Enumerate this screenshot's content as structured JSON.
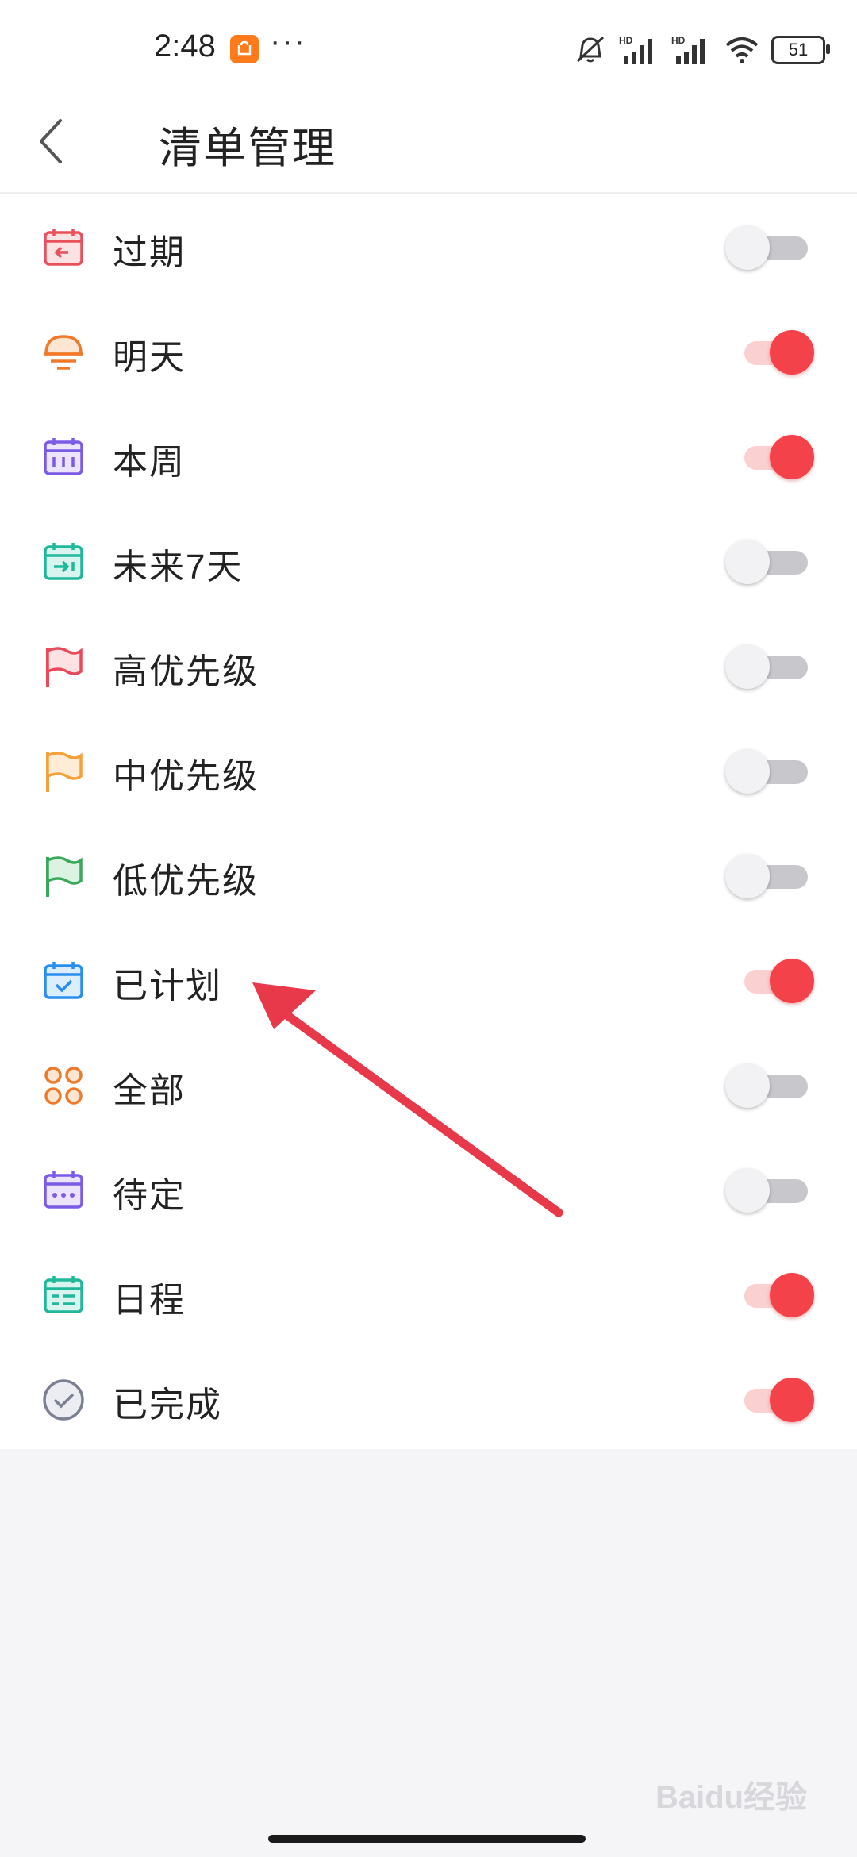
{
  "status_bar": {
    "time": "2:48",
    "dots": "···",
    "battery": "51",
    "icons": [
      "taobao-app-icon",
      "mute-icon",
      "signal-hd-icon",
      "signal-hd-icon",
      "wifi-icon",
      "battery-icon"
    ]
  },
  "header": {
    "title": "清单管理",
    "back_icon": "chevron-left-icon"
  },
  "items": [
    {
      "label": "过期",
      "icon": "calendar-back-icon",
      "color": "#e8505b",
      "enabled": false
    },
    {
      "label": "明天",
      "icon": "sun-icon",
      "color": "#f07a2a",
      "enabled": true
    },
    {
      "label": "本周",
      "icon": "calendar-week-icon",
      "color": "#7b5be6",
      "enabled": true
    },
    {
      "label": "未来7天",
      "icon": "calendar-next-icon",
      "color": "#1fb89a",
      "enabled": false
    },
    {
      "label": "高优先级",
      "icon": "flag-icon",
      "color": "#e84a5a",
      "enabled": false
    },
    {
      "label": "中优先级",
      "icon": "flag-icon",
      "color": "#f5a13a",
      "enabled": false
    },
    {
      "label": "低优先级",
      "icon": "flag-icon",
      "color": "#3aa85a",
      "enabled": false
    },
    {
      "label": "已计划",
      "icon": "calendar-check-icon",
      "color": "#2a8ef0",
      "enabled": true
    },
    {
      "label": "全部",
      "icon": "grid-circles-icon",
      "color": "#f07a2a",
      "enabled": false
    },
    {
      "label": "待定",
      "icon": "calendar-dots-icon",
      "color": "#7b5be6",
      "enabled": false
    },
    {
      "label": "日程",
      "icon": "calendar-list-icon",
      "color": "#1fb89a",
      "enabled": true
    },
    {
      "label": "已完成",
      "icon": "check-circle-icon",
      "color": "#7a7f92",
      "enabled": true
    }
  ],
  "annotation": {
    "color": "#e8394a"
  },
  "watermark": "Baidu经验"
}
